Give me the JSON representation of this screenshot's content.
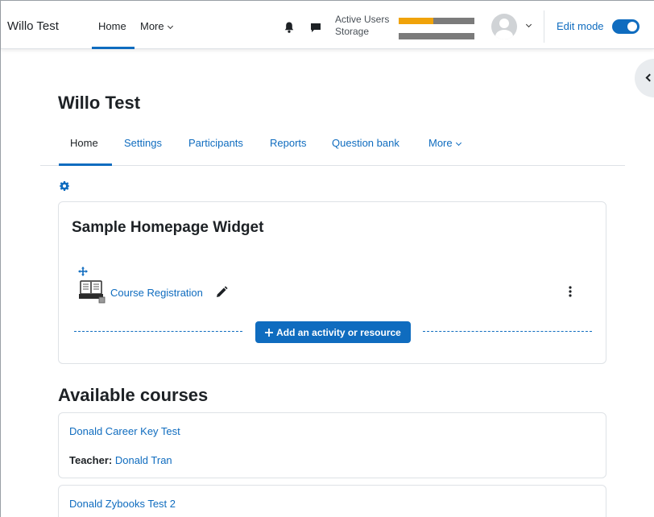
{
  "navbar": {
    "brand": "Willo Test",
    "home": "Home",
    "more": "More",
    "meters": {
      "active_users_label": "Active Users",
      "storage_label": "Storage",
      "active_users_fraction": 0.46,
      "storage_fraction": 0.0,
      "fill_color": "#f0a30a",
      "track_color": "#7b7b7b"
    },
    "edit_mode_label": "Edit mode",
    "edit_mode_on": true
  },
  "page": {
    "title": "Willo Test",
    "tabs": [
      {
        "label": "Home",
        "active": true
      },
      {
        "label": "Settings"
      },
      {
        "label": "Participants"
      },
      {
        "label": "Reports"
      },
      {
        "label": "Question bank"
      },
      {
        "label": "More"
      }
    ]
  },
  "widget": {
    "title": "Sample Homepage Widget",
    "activity": "Course Registration",
    "add_button": "Add an activity or resource"
  },
  "courses": {
    "title": "Available courses",
    "items": [
      {
        "name": "Donald Career Key Test",
        "teacher_label": "Teacher:",
        "teacher": "Donald Tran"
      },
      {
        "name": "Donald Zybooks Test 2"
      }
    ]
  },
  "colors": {
    "accent": "#0f6cbf",
    "text": "#1d2125",
    "border": "#dee2e6"
  }
}
